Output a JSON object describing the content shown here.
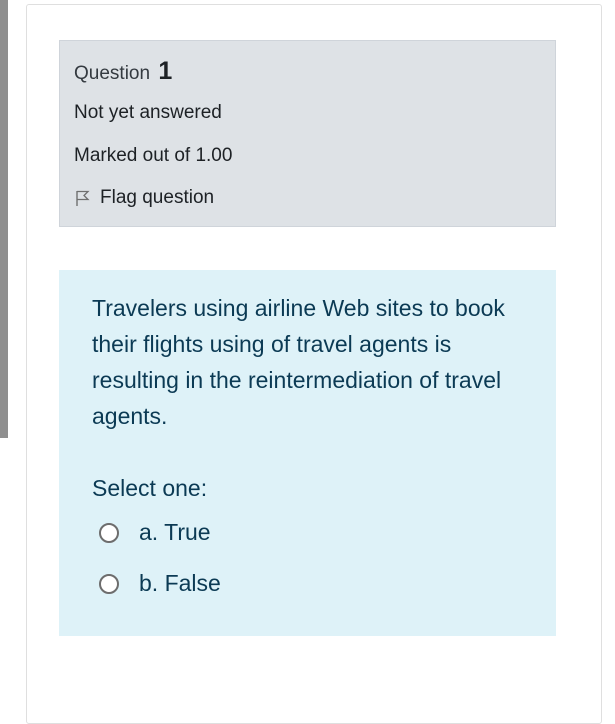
{
  "question_info": {
    "label": "Question",
    "number": "1",
    "state": "Not yet answered",
    "grade": "Marked out of 1.00",
    "flag_label": "Flag question"
  },
  "question": {
    "text": "Travelers using airline Web sites to book their flights using of travel agents is resulting in the reintermediation of travel agents.",
    "prompt": "Select one:",
    "options": [
      {
        "label": "a. True",
        "selected": false
      },
      {
        "label": "b. False",
        "selected": false
      }
    ]
  },
  "colors": {
    "info_bg": "#dee2e6",
    "formulation_bg": "#def2f8",
    "question_text": "#0b3a54"
  },
  "icons": {
    "flag": "flag-outline-icon"
  }
}
